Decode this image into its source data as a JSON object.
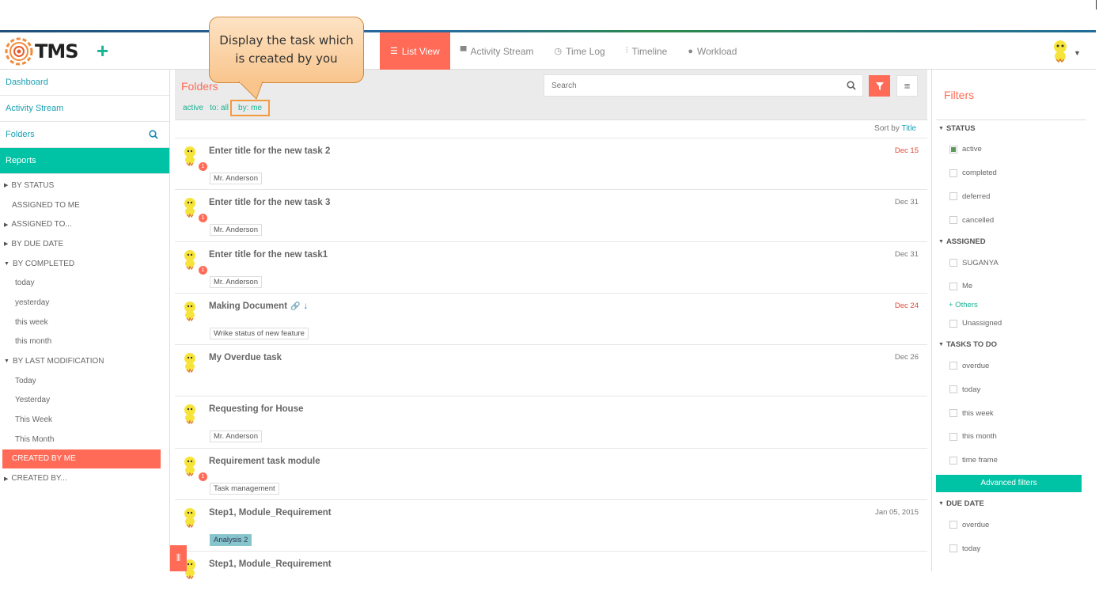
{
  "header": {
    "logo_text": "TMS",
    "nav": [
      {
        "label": "List View",
        "icon": "list-icon",
        "active": true
      },
      {
        "label": "Activity Stream",
        "icon": "comment-icon",
        "active": false
      },
      {
        "label": "Time Log",
        "icon": "clock-icon",
        "active": false
      },
      {
        "label": "Timeline",
        "icon": "timeline-icon",
        "active": false
      },
      {
        "label": "Workload",
        "icon": "user-icon",
        "active": false
      }
    ]
  },
  "sidebar": {
    "links": [
      "Dashboard",
      "Activity Stream",
      "Folders",
      "Reports"
    ],
    "reports": [
      {
        "label": "BY STATUS",
        "type": "group"
      },
      {
        "label": "ASSIGNED TO ME",
        "type": "plain"
      },
      {
        "label": "ASSIGNED TO...",
        "type": "group"
      },
      {
        "label": "BY DUE DATE",
        "type": "group"
      },
      {
        "label": "BY COMPLETED",
        "type": "group-open"
      },
      {
        "label": "today",
        "type": "sub"
      },
      {
        "label": "yesterday",
        "type": "sub"
      },
      {
        "label": "this week",
        "type": "sub"
      },
      {
        "label": "this month",
        "type": "sub"
      },
      {
        "label": "BY LAST MODIFICATION",
        "type": "group-open"
      },
      {
        "label": "Today",
        "type": "sub"
      },
      {
        "label": "Yesterday",
        "type": "sub"
      },
      {
        "label": "This Week",
        "type": "sub"
      },
      {
        "label": "This Month",
        "type": "sub"
      },
      {
        "label": "CREATED BY ME",
        "type": "selected"
      },
      {
        "label": "CREATED BY...",
        "type": "group"
      }
    ]
  },
  "main": {
    "title": "Folders",
    "crumbs": [
      "active",
      "to: all",
      "by: me"
    ],
    "search_placeholder": "Search",
    "sort_prefix": "Sort by",
    "sort_field": "Title",
    "tasks": [
      {
        "title": "Enter title for the new task 2",
        "date": "Dec 15",
        "overdue": true,
        "tag": "Mr. Anderson",
        "badge": "1"
      },
      {
        "title": "Enter title for the new task 3",
        "date": "Dec 31",
        "overdue": false,
        "tag": "Mr. Anderson",
        "badge": "1"
      },
      {
        "title": "Enter title for the new task1",
        "date": "Dec 31",
        "overdue": false,
        "tag": "Mr. Anderson",
        "badge": "1"
      },
      {
        "title": "Making Document",
        "date": "Dec 24",
        "overdue": true,
        "tag": "Wrike status of new feature",
        "badge": "",
        "extra": true
      },
      {
        "title": "My Overdue task",
        "date": "Dec 26",
        "overdue": false,
        "tag": "",
        "badge": ""
      },
      {
        "title": "Requesting for House",
        "date": "",
        "overdue": false,
        "tag": "Mr. Anderson",
        "badge": ""
      },
      {
        "title": "Requirement task module",
        "date": "",
        "overdue": false,
        "tag": "Task management",
        "badge": "1"
      },
      {
        "title": "Step1, Module_Requirement",
        "date": "Jan 05, 2015",
        "overdue": false,
        "tag": "Analysis 2",
        "badge": "",
        "tag_colored": true
      },
      {
        "title": "Step1, Module_Requirement",
        "date": "",
        "overdue": false,
        "tag": "",
        "badge": ""
      }
    ]
  },
  "filters": {
    "title": "Filters",
    "advanced_label": "Advanced filters",
    "others_label": "+ Others",
    "sections": [
      {
        "name": "STATUS",
        "rows": [
          {
            "label": "active",
            "checked": true
          },
          {
            "label": "completed"
          },
          {
            "label": "deferred"
          },
          {
            "label": "cancelled"
          }
        ]
      },
      {
        "name": "ASSIGNED",
        "rows": [
          {
            "label": "SUGANYA"
          },
          {
            "label": "Me"
          }
        ],
        "others": true,
        "after": [
          {
            "label": "Unassigned"
          }
        ]
      },
      {
        "name": "TASKS TO DO",
        "rows": [
          {
            "label": "overdue"
          },
          {
            "label": "today"
          },
          {
            "label": "this week"
          },
          {
            "label": "this month"
          },
          {
            "label": "time frame"
          }
        ],
        "advanced": true
      },
      {
        "name": "DUE DATE",
        "rows": [
          {
            "label": "overdue"
          },
          {
            "label": "today"
          }
        ]
      }
    ]
  },
  "callout": {
    "text": "Display the task which is created by you"
  },
  "colors": {
    "accent": "#ff6b57",
    "teal": "#00c3a5",
    "link": "#1aa0b4"
  }
}
